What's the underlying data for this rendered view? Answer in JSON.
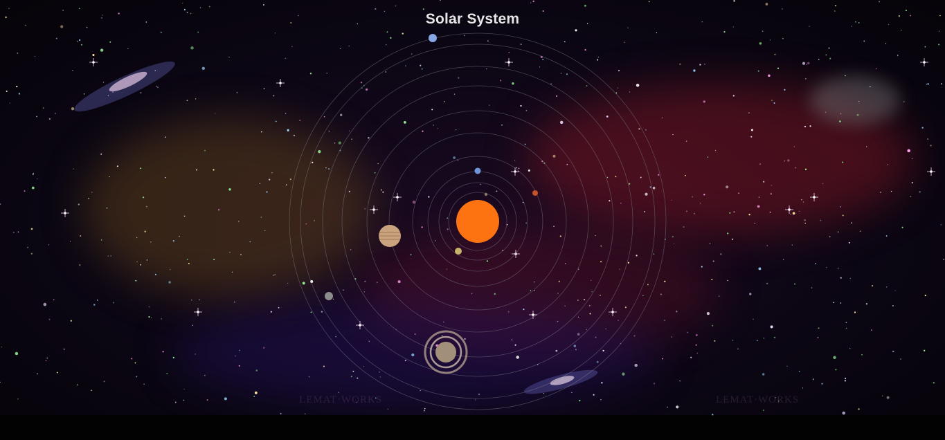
{
  "title": "Solar System",
  "watermark": "LEMAT·WORKS",
  "colors": {
    "sun": "#fd7312",
    "orbit": "#8a8a96",
    "background": "#0b0613"
  },
  "sun": {
    "name": "sun"
  },
  "planets": [
    {
      "name": "mercury",
      "color": "#8d7a6b"
    },
    {
      "name": "venus",
      "color": "#c7b26b"
    },
    {
      "name": "earth",
      "color": "#6f96dc"
    },
    {
      "name": "mars",
      "color": "#c4532a"
    },
    {
      "name": "jupiter",
      "color": "#c9a27e"
    },
    {
      "name": "saturn",
      "color": "#a28f7a"
    },
    {
      "name": "uranus",
      "color": "#8c8c8c"
    },
    {
      "name": "neptune",
      "color": "#86a6e6"
    }
  ]
}
